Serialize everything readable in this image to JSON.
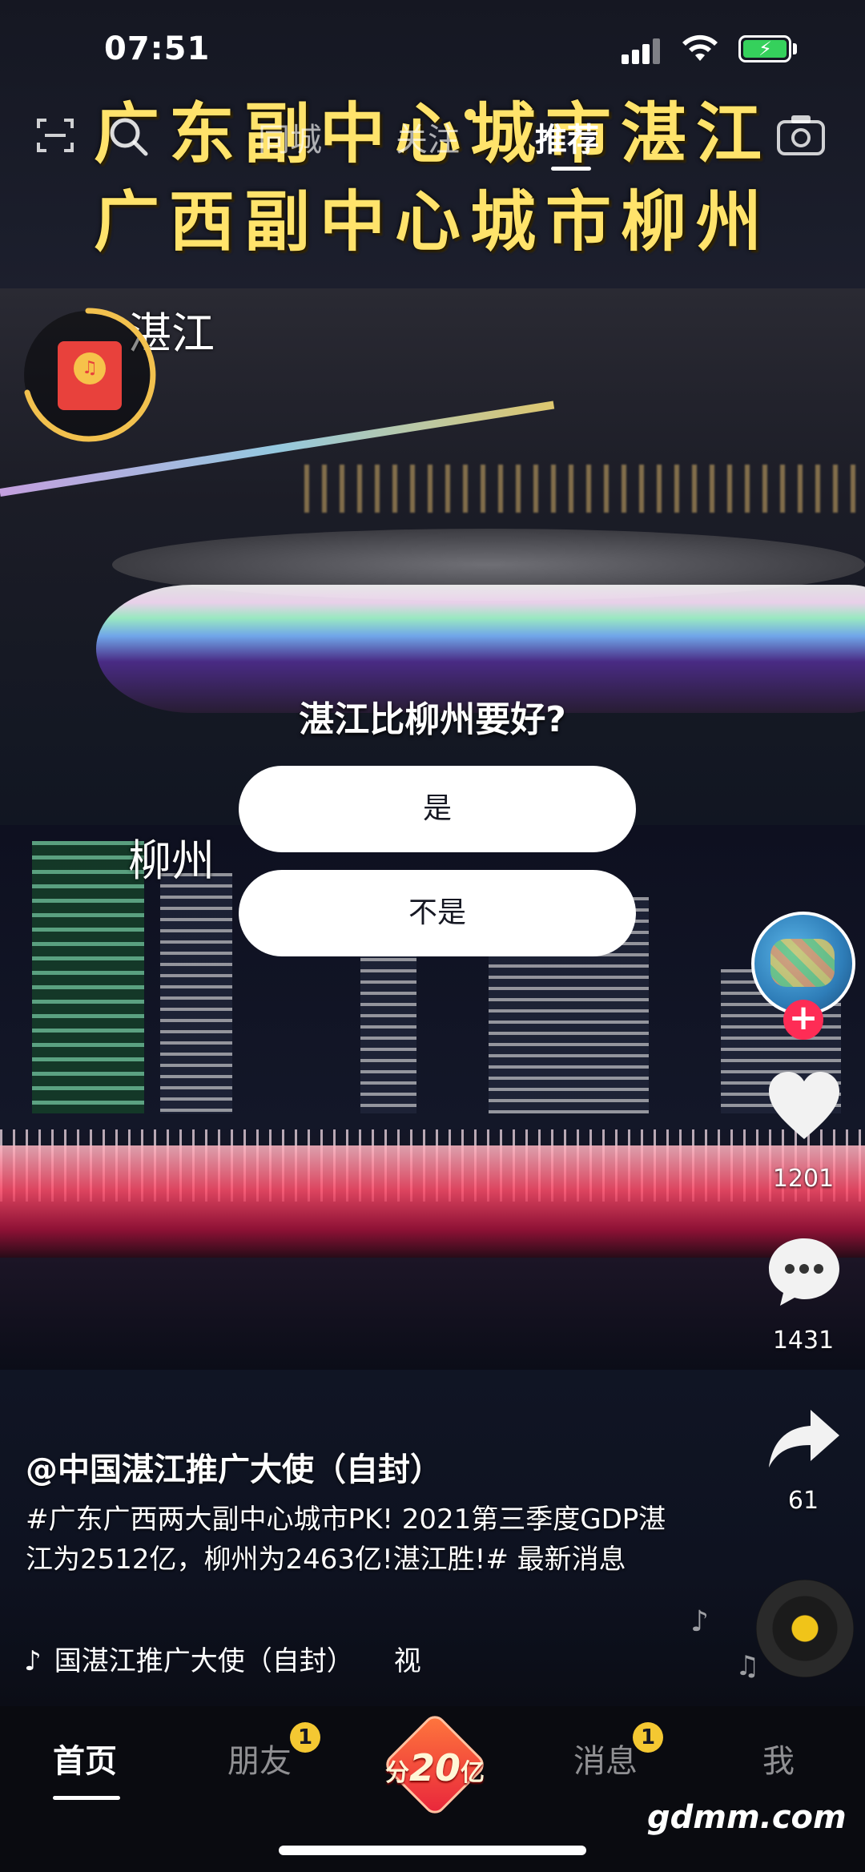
{
  "status_bar": {
    "time": "07:51"
  },
  "caption": {
    "line1": "广东副中心城市湛江",
    "line2": "广西副中心城市柳州"
  },
  "top_nav": {
    "tabs": [
      {
        "label": "同城",
        "active": false
      },
      {
        "label": "关注",
        "active": false
      },
      {
        "label": "推荐",
        "active": true
      }
    ]
  },
  "scene_labels": {
    "top": "湛江",
    "bottom": "柳州"
  },
  "poll": {
    "question": "湛江比柳州要好?",
    "options": [
      "是",
      "不是"
    ]
  },
  "right_rail": {
    "likes": "1201",
    "comments": "1431",
    "shares": "61"
  },
  "video_info": {
    "author": "@中国湛江推广大使（自封）",
    "description": "#广东广西两大副中心城市PK! 2021第三季度GDP湛江为2512亿，柳州为2463亿!湛江胜!# 最新消息",
    "music": {
      "icon": "tiktok-note-icon",
      "title": "国湛江推广大使（自封）",
      "extra": "视"
    }
  },
  "bottom_nav": {
    "items": [
      {
        "label": "首页",
        "active": true
      },
      {
        "label": "朋友",
        "badge": "1"
      },
      {
        "label": "消息",
        "badge": "1"
      },
      {
        "label": "我"
      }
    ],
    "center": {
      "prefix": "分",
      "amount": "20",
      "suffix": "亿"
    }
  },
  "watermark": "gdmm.com",
  "colors": {
    "caption_yellow": "#ffe36b",
    "follow_red": "#fe2c55",
    "badge_yellow": "#f4c832",
    "redpacket_red": "#e8413c"
  }
}
